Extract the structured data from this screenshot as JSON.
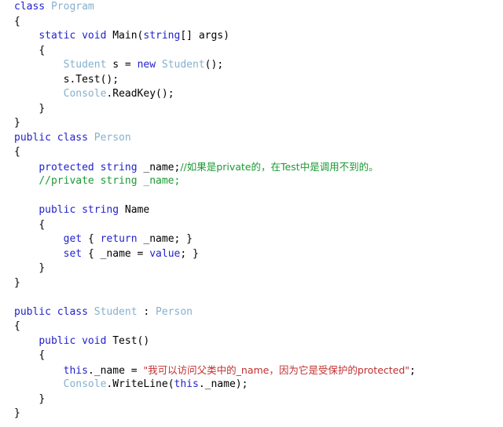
{
  "document": {
    "kind": "code-snippet",
    "language": "C#",
    "background_color": "#ffffff",
    "font_size_px": 13,
    "line_height_px": 18.5
  },
  "colors": {
    "plain": "#000000",
    "keyword": "#2222cc",
    "type": "#85b0cc",
    "comment": "#1c9a34",
    "string": "#c03030",
    "background": "#ffffff"
  },
  "code": {
    "lines": [
      {
        "indent": 0,
        "tokens": [
          {
            "text": "class ",
            "kind": "keyword"
          },
          {
            "text": "Program",
            "kind": "type"
          }
        ]
      },
      {
        "indent": 0,
        "tokens": [
          {
            "text": "{",
            "kind": "plain"
          }
        ]
      },
      {
        "indent": 1,
        "tokens": [
          {
            "text": "static void ",
            "kind": "keyword"
          },
          {
            "text": "Main(",
            "kind": "plain"
          },
          {
            "text": "string",
            "kind": "keyword"
          },
          {
            "text": "[] args)",
            "kind": "plain"
          }
        ]
      },
      {
        "indent": 1,
        "tokens": [
          {
            "text": "{",
            "kind": "plain"
          }
        ]
      },
      {
        "indent": 2,
        "tokens": [
          {
            "text": "Student",
            "kind": "type"
          },
          {
            "text": " s = ",
            "kind": "plain"
          },
          {
            "text": "new ",
            "kind": "keyword"
          },
          {
            "text": "Student",
            "kind": "type"
          },
          {
            "text": "();",
            "kind": "plain"
          }
        ]
      },
      {
        "indent": 2,
        "tokens": [
          {
            "text": "s.Test();",
            "kind": "plain"
          }
        ]
      },
      {
        "indent": 2,
        "tokens": [
          {
            "text": "Console",
            "kind": "type"
          },
          {
            "text": ".ReadKey();",
            "kind": "plain"
          }
        ]
      },
      {
        "indent": 1,
        "tokens": [
          {
            "text": "}",
            "kind": "plain"
          }
        ]
      },
      {
        "indent": 0,
        "tokens": [
          {
            "text": "}",
            "kind": "plain"
          }
        ]
      },
      {
        "indent": 0,
        "tokens": [
          {
            "text": "public class ",
            "kind": "keyword"
          },
          {
            "text": "Person",
            "kind": "type"
          }
        ]
      },
      {
        "indent": 0,
        "tokens": [
          {
            "text": "{",
            "kind": "plain"
          }
        ]
      },
      {
        "indent": 1,
        "tokens": [
          {
            "text": "protected string ",
            "kind": "keyword"
          },
          {
            "text": "_name;",
            "kind": "plain"
          },
          {
            "text": "//如果是private的，在Test中是调用不到的。",
            "kind": "comment"
          }
        ]
      },
      {
        "indent": 1,
        "tokens": [
          {
            "text": "//private string _name;",
            "kind": "comment"
          }
        ]
      },
      {
        "indent": 0,
        "tokens": []
      },
      {
        "indent": 1,
        "tokens": [
          {
            "text": "public string ",
            "kind": "keyword"
          },
          {
            "text": "Name",
            "kind": "plain"
          }
        ]
      },
      {
        "indent": 1,
        "tokens": [
          {
            "text": "{",
            "kind": "plain"
          }
        ]
      },
      {
        "indent": 2,
        "tokens": [
          {
            "text": "get ",
            "kind": "keyword"
          },
          {
            "text": "{ ",
            "kind": "plain"
          },
          {
            "text": "return ",
            "kind": "keyword"
          },
          {
            "text": "_name; }",
            "kind": "plain"
          }
        ]
      },
      {
        "indent": 2,
        "tokens": [
          {
            "text": "set ",
            "kind": "keyword"
          },
          {
            "text": "{ _name = ",
            "kind": "plain"
          },
          {
            "text": "value",
            "kind": "keyword"
          },
          {
            "text": "; }",
            "kind": "plain"
          }
        ]
      },
      {
        "indent": 1,
        "tokens": [
          {
            "text": "}",
            "kind": "plain"
          }
        ]
      },
      {
        "indent": 0,
        "tokens": [
          {
            "text": "}",
            "kind": "plain"
          }
        ]
      },
      {
        "indent": 0,
        "tokens": []
      },
      {
        "indent": 0,
        "tokens": [
          {
            "text": "public class ",
            "kind": "keyword"
          },
          {
            "text": "Student",
            "kind": "type"
          },
          {
            "text": " : ",
            "kind": "plain"
          },
          {
            "text": "Person",
            "kind": "type"
          }
        ]
      },
      {
        "indent": 0,
        "tokens": [
          {
            "text": "{",
            "kind": "plain"
          }
        ]
      },
      {
        "indent": 1,
        "tokens": [
          {
            "text": "public void ",
            "kind": "keyword"
          },
          {
            "text": "Test()",
            "kind": "plain"
          }
        ]
      },
      {
        "indent": 1,
        "tokens": [
          {
            "text": "{",
            "kind": "plain"
          }
        ]
      },
      {
        "indent": 2,
        "tokens": [
          {
            "text": "this",
            "kind": "keyword"
          },
          {
            "text": "._name = ",
            "kind": "plain"
          },
          {
            "text": "\"我可以访问父类中的_name，因为它是受保护的protected\"",
            "kind": "string"
          },
          {
            "text": ";",
            "kind": "plain"
          }
        ]
      },
      {
        "indent": 2,
        "tokens": [
          {
            "text": "Console",
            "kind": "type"
          },
          {
            "text": ".WriteLine(",
            "kind": "plain"
          },
          {
            "text": "this",
            "kind": "keyword"
          },
          {
            "text": "._name);",
            "kind": "plain"
          }
        ]
      },
      {
        "indent": 1,
        "tokens": [
          {
            "text": "}",
            "kind": "plain"
          }
        ]
      },
      {
        "indent": 0,
        "tokens": [
          {
            "text": "}",
            "kind": "plain"
          }
        ]
      }
    ]
  }
}
